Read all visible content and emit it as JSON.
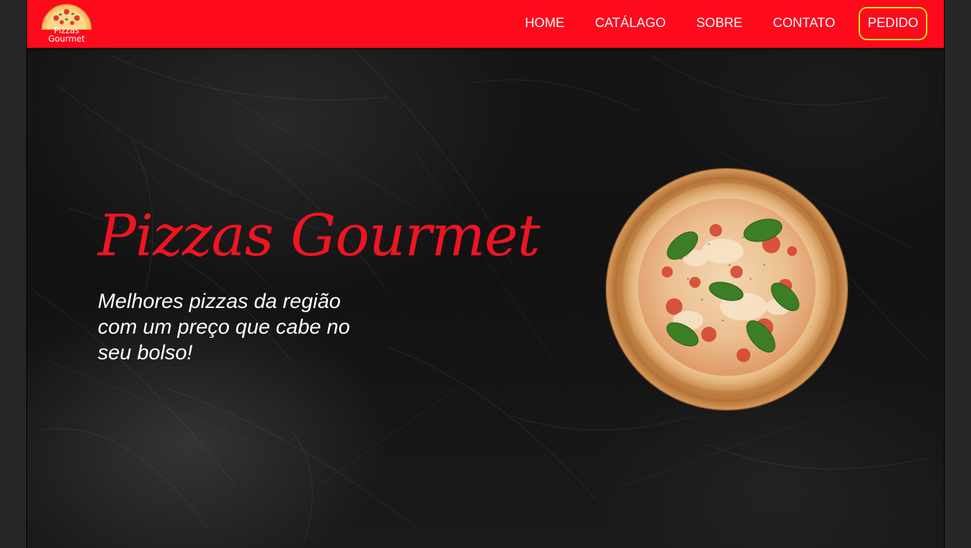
{
  "logo": {
    "line1": "Pizzas",
    "line2": "Gourmet",
    "icon": "pizza-slice-icon"
  },
  "nav": {
    "items": [
      {
        "label": "HOME"
      },
      {
        "label": "CATÁLAGO"
      },
      {
        "label": "SOBRE"
      },
      {
        "label": "CONTATO"
      }
    ],
    "order_label": "PEDIDO"
  },
  "hero": {
    "title": "Pizzas Gourmet",
    "subtitle": "Melhores pizzas da região com um preço que cabe no seu bolso!",
    "image": "margherita-pizza-image"
  },
  "colors": {
    "brand_red": "#fe0a1d",
    "title_red": "#f01422",
    "order_border": "#f4ec22",
    "background": "#121212"
  }
}
